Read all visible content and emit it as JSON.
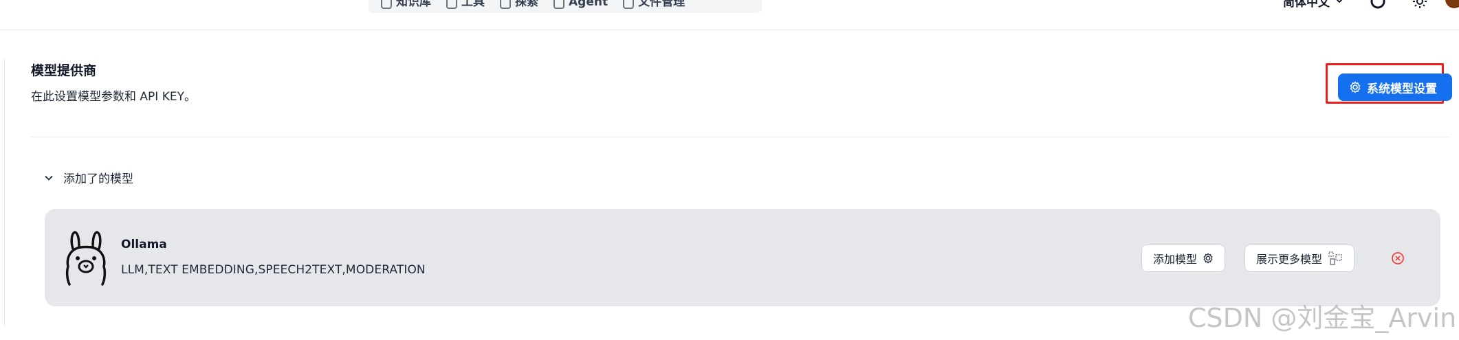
{
  "topnav": {
    "items": [
      {
        "label": "知识库",
        "icon": "book-icon"
      },
      {
        "label": "工具",
        "icon": "tool-icon"
      },
      {
        "label": "探索",
        "icon": "compass-icon"
      },
      {
        "label": "Agent",
        "icon": "agent-icon"
      },
      {
        "label": "文件管理",
        "icon": "folder-icon"
      }
    ],
    "language": "简体中文"
  },
  "header": {
    "title": "模型提供商",
    "subtitle": "在此设置模型参数和 API KEY。",
    "system_settings_label": "系统模型设置"
  },
  "section": {
    "title": "添加了的模型"
  },
  "provider": {
    "name": "Ollama",
    "types": "LLM,TEXT EMBEDDING,SPEECH2TEXT,MODERATION",
    "add_model_label": "添加模型",
    "show_more_label": "展示更多模型"
  },
  "watermark": "CSDN @刘金宝_Arvin",
  "colors": {
    "primary": "#1570ef",
    "highlight_frame": "#ef1c1c",
    "card_bg": "#e5e7eb",
    "danger": "#f04438"
  }
}
